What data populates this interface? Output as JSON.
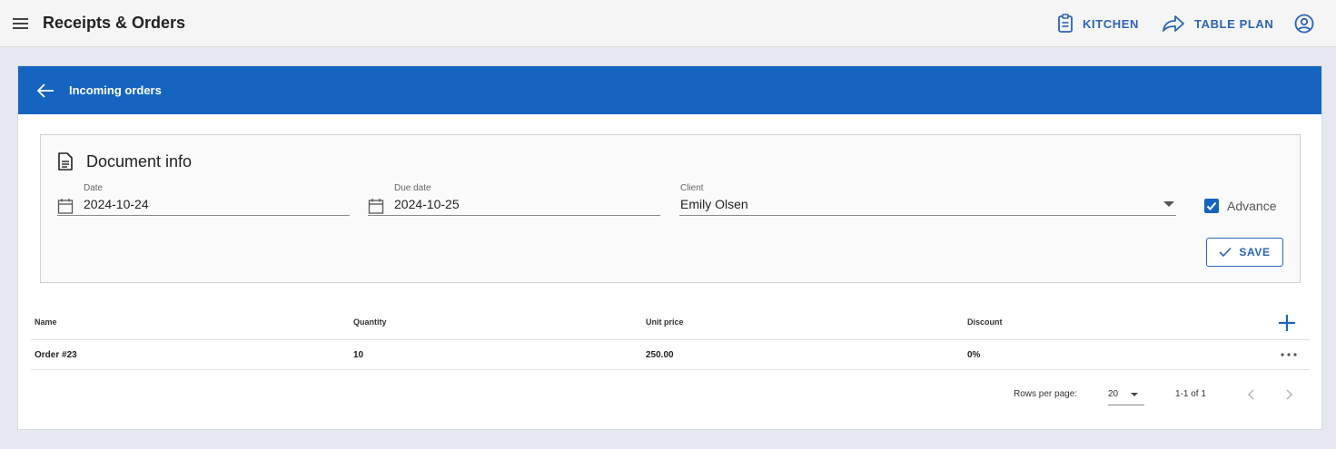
{
  "app": {
    "title": "Receipts & Orders"
  },
  "nav": {
    "kitchen_label": "KITCHEN",
    "table_plan_label": "TABLE PLAN"
  },
  "card": {
    "title": "Incoming orders"
  },
  "document": {
    "title": "Document info",
    "date": {
      "label": "Date",
      "value": "2024-10-24"
    },
    "due_date": {
      "label": "Due date",
      "value": "2024-10-25"
    },
    "client": {
      "label": "Client",
      "value": "Emily Olsen"
    },
    "advance": {
      "label": "Advance",
      "checked": true
    },
    "save_label": "SAVE"
  },
  "table": {
    "columns": [
      "Name",
      "Quantity",
      "Unit price",
      "Discount"
    ],
    "rows": [
      {
        "name": "Order #23",
        "quantity": "10",
        "unit_price": "250.00",
        "discount": "0%"
      }
    ]
  },
  "pagination": {
    "rows_per_page_label": "Rows per page:",
    "rows_per_page": "20",
    "range": "1-1 of 1"
  },
  "colors": {
    "accent": "#1565c0",
    "link": "#2a63b8"
  }
}
